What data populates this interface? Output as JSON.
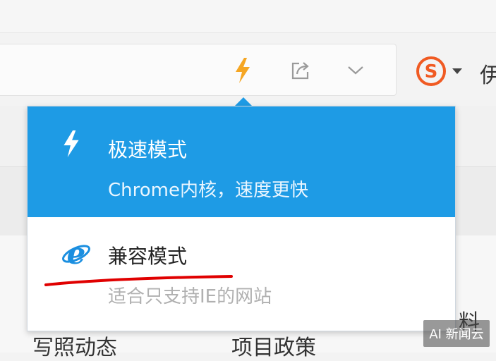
{
  "toolbar": {
    "icons": {
      "speed": "lightning-icon",
      "share": "share-icon",
      "more": "chevron-down-icon",
      "sogou": "sogou-s-icon"
    },
    "right_partial_text": "伊"
  },
  "background": {
    "text_1": "写照动态",
    "text_2": "项目政策",
    "text_3": "料"
  },
  "mode_menu": {
    "fast": {
      "title": "极速模式",
      "description": "Chrome内核，速度更快",
      "icon": "lightning-icon"
    },
    "compat": {
      "title": "兼容模式",
      "description": "适合只支持IE的网站",
      "icon": "ie-icon"
    }
  },
  "watermark": {
    "text": "AI 新闻云"
  },
  "colors": {
    "accent": "#1e9be5",
    "speed_icon": "#f5a623",
    "sogou": "#f05a22",
    "ie_icon": "#1b8fe0",
    "annotation": "#e00000"
  }
}
